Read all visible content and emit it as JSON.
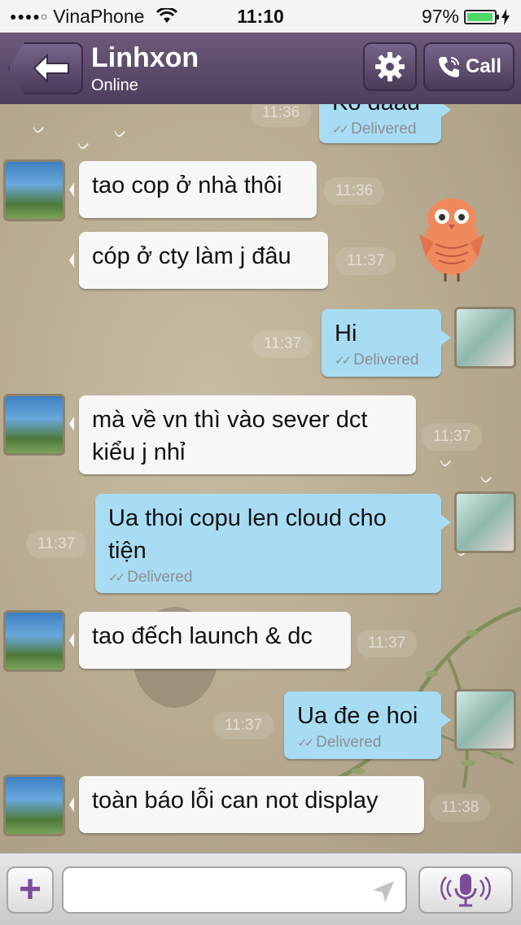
{
  "status_bar": {
    "signal": "●●●●○",
    "carrier": "VinaPhone",
    "time": "11:10",
    "battery": "97%",
    "battery_level": 0.97
  },
  "header": {
    "title": "Linhxon",
    "subtitle": "Online",
    "call_label": "Call"
  },
  "chat": {
    "top_partial": {
      "text": "Ko daau",
      "status": "Delivered",
      "time": "11:36"
    },
    "messages": [
      {
        "side": "in",
        "text": "tao cop ở nhà thôi",
        "time": "11:36"
      },
      {
        "side": "in",
        "text": "cóp ở cty làm j đâu",
        "time": "11:37"
      },
      {
        "side": "out",
        "text": "Hi",
        "status": "Delivered",
        "time": "11:37"
      },
      {
        "side": "in",
        "text": "mà về vn thì vào sever dct kiểu j nhỉ",
        "time": "11:37"
      },
      {
        "side": "out",
        "text": "Ua thoi copu len cloud cho tiện",
        "status": "Delivered",
        "time": "11:37"
      },
      {
        "side": "in",
        "text": "tao đếch launch & dc",
        "time": "11:37"
      },
      {
        "side": "out",
        "text": "Ua đe e hoi",
        "status": "Delivered",
        "time": "11:37"
      },
      {
        "side": "in",
        "text": "toàn báo lỗi can not display",
        "time": "11:38"
      }
    ]
  },
  "composer": {
    "plus_label": "+",
    "placeholder": ""
  },
  "colors": {
    "header": "#5b4869",
    "incoming_bubble": "#f7f7f7",
    "outgoing_bubble": "#a8dcf3",
    "accent": "#7a4d9a"
  }
}
